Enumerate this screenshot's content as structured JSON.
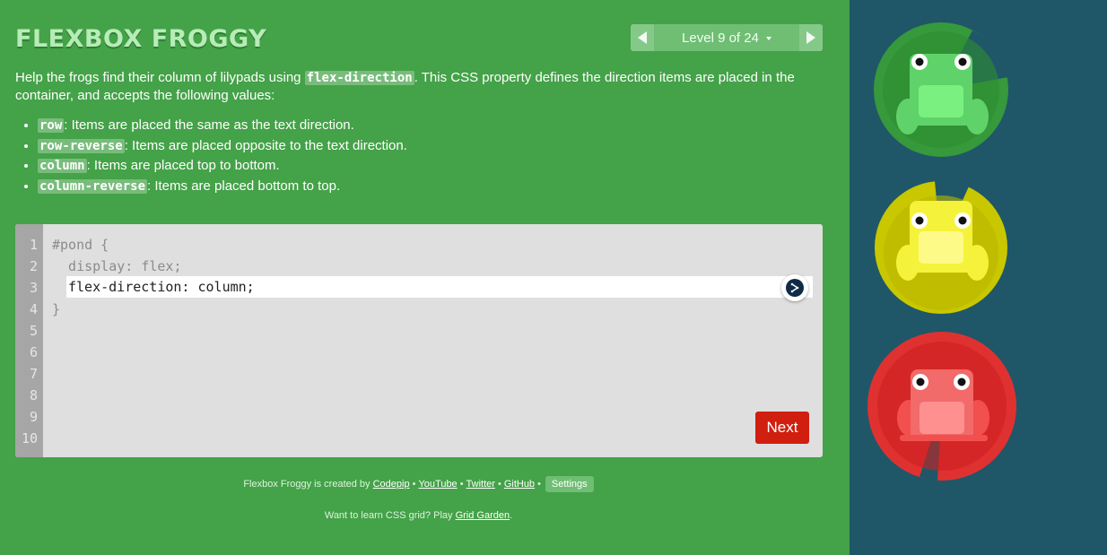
{
  "header": {
    "logo": "FLEXBOX FROGGY",
    "level_label": "Level 9 of 24"
  },
  "instructions": {
    "intro_before": "Help the frogs find their column of lilypads using ",
    "intro_code": "flex-direction",
    "intro_after": ". This CSS property defines the direction items are placed in the container, and accepts the following values:",
    "values": [
      {
        "code": "row",
        "text": ": Items are placed the same as the text direction."
      },
      {
        "code": "row-reverse",
        "text": ": Items are placed opposite to the text direction."
      },
      {
        "code": "column",
        "text": ": Items are placed top to bottom."
      },
      {
        "code": "column-reverse",
        "text": ": Items are placed bottom to top."
      }
    ]
  },
  "editor": {
    "line_numbers": [
      "1",
      "2",
      "3",
      "4",
      "5",
      "6",
      "7",
      "8",
      "9",
      "10"
    ],
    "line1": "#pond {",
    "line2": "  display: flex;",
    "input_value": "flex-direction: column;",
    "line4": "}",
    "next_label": "Next"
  },
  "credits": {
    "prefix": "Flexbox Froggy is created by",
    "codepip": "Codepip",
    "youtube": "YouTube",
    "twitter": "Twitter",
    "github": "GitHub",
    "bullet": "•",
    "settings": "Settings",
    "grid_prefix": "Want to learn CSS grid? Play",
    "grid_link": "Grid Garden",
    "grid_suffix": "."
  },
  "icons": {
    "prev": "chevron-left-icon",
    "next": "chevron-right-icon",
    "dropdown": "caret-down-icon",
    "translate": "deepl-translate-icon"
  },
  "colors": {
    "sidebar": "#44a248",
    "pond": "#1f5768",
    "next_button": "#d11f0f",
    "frog_green": "#5fd36a",
    "frog_yellow": "#f5f23c",
    "frog_red": "#f24f4f"
  }
}
